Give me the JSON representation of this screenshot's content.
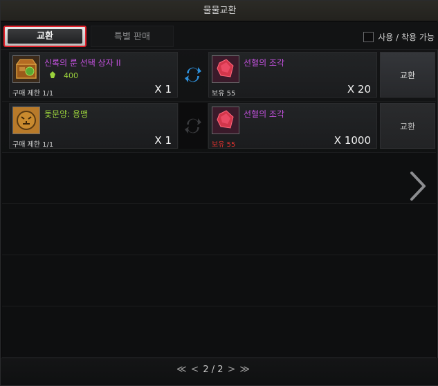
{
  "window": {
    "title": "물물교환"
  },
  "tabs": [
    {
      "label": "교환",
      "active": true
    },
    {
      "label": "특별 판매",
      "active": false
    }
  ],
  "filter": {
    "label": "사용 / 착용 가능",
    "checked": false
  },
  "rows": [
    {
      "give": {
        "name": "신록의 룬 선택 상자 II",
        "cost": "400",
        "limit": "구매 제한 1/1",
        "qty": "X 1"
      },
      "get": {
        "name": "선혈의 조각",
        "owned": "보유 55",
        "qty": "X 20"
      },
      "button": "교환"
    },
    {
      "give": {
        "name": "돛문양: 용맹",
        "limit": "구매 제한 1/1",
        "qty": "X 1"
      },
      "get": {
        "name": "선혈의 조각",
        "owned": "보유 55",
        "qty": "X 1000"
      },
      "button": "교환"
    }
  ],
  "pagination": {
    "first": "≪",
    "prev": "<",
    "text": "2 / 2",
    "next": ">",
    "last": "≫"
  },
  "colors": {
    "accent_red": "#e0202a",
    "name_purple": "#c552e0",
    "name_green": "#9bd23c",
    "owned_red": "#e0322f",
    "swap_blue": "#2f8fd8"
  },
  "icons": [
    "rune-chest-icon",
    "soul-icon",
    "blood-shard-icon",
    "tiger-crest-icon",
    "swap-arrows-icon",
    "chevron-right-icon"
  ]
}
